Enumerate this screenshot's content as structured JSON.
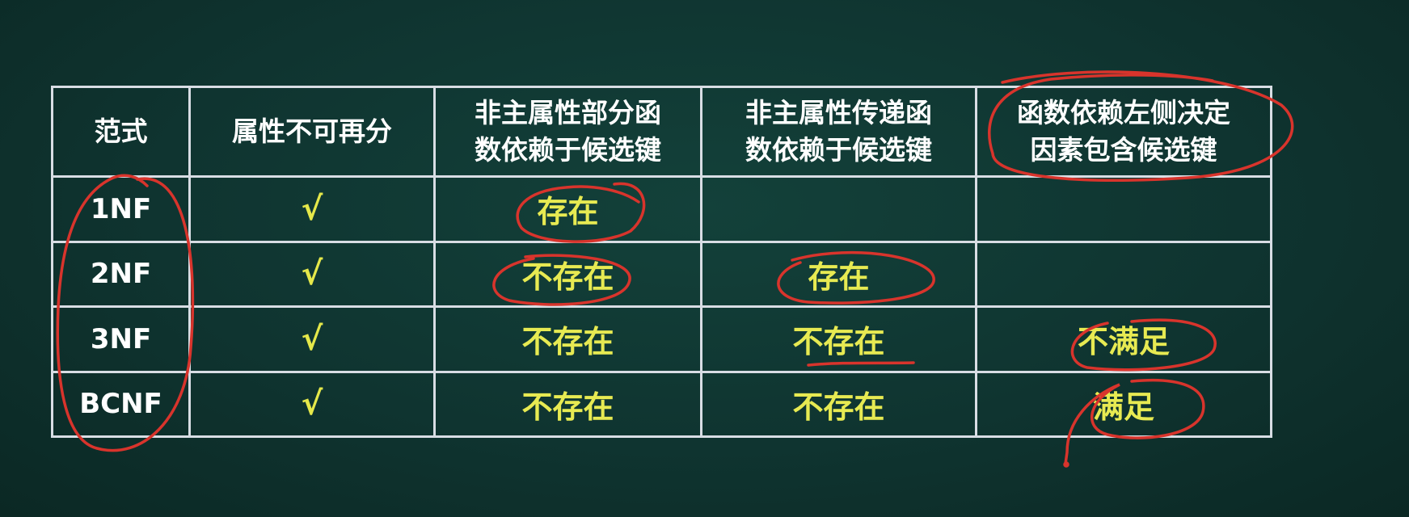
{
  "table": {
    "headers": [
      "范式",
      "属性不可再分",
      "非主属性部分函数依赖于候选键",
      "非主属性传递函数依赖于候选键",
      "函数依赖左侧决定因素包含候选键"
    ],
    "header_lines": [
      [
        "范式"
      ],
      [
        "属性不可再分"
      ],
      [
        "非主属性部分函",
        "数依赖于候选键"
      ],
      [
        "非主属性传递函",
        "数依赖于候选键"
      ],
      [
        "函数依赖左侧决定",
        "因素包含候选键"
      ]
    ],
    "rows": [
      {
        "form": "1NF",
        "atomic": "√",
        "partial": "存在",
        "transitive": "",
        "determinant": ""
      },
      {
        "form": "2NF",
        "atomic": "√",
        "partial": "不存在",
        "transitive": "存在",
        "determinant": ""
      },
      {
        "form": "3NF",
        "atomic": "√",
        "partial": "不存在",
        "transitive": "不存在",
        "determinant": "不满足"
      },
      {
        "form": "BCNF",
        "atomic": "√",
        "partial": "不存在",
        "transitive": "不存在",
        "determinant": "满足"
      }
    ]
  },
  "colors": {
    "background": "#0f3430",
    "grid": "#d8dde4",
    "header_text": "#ffffff",
    "value_text": "#e7ea52",
    "annotation": "#d8342c"
  }
}
